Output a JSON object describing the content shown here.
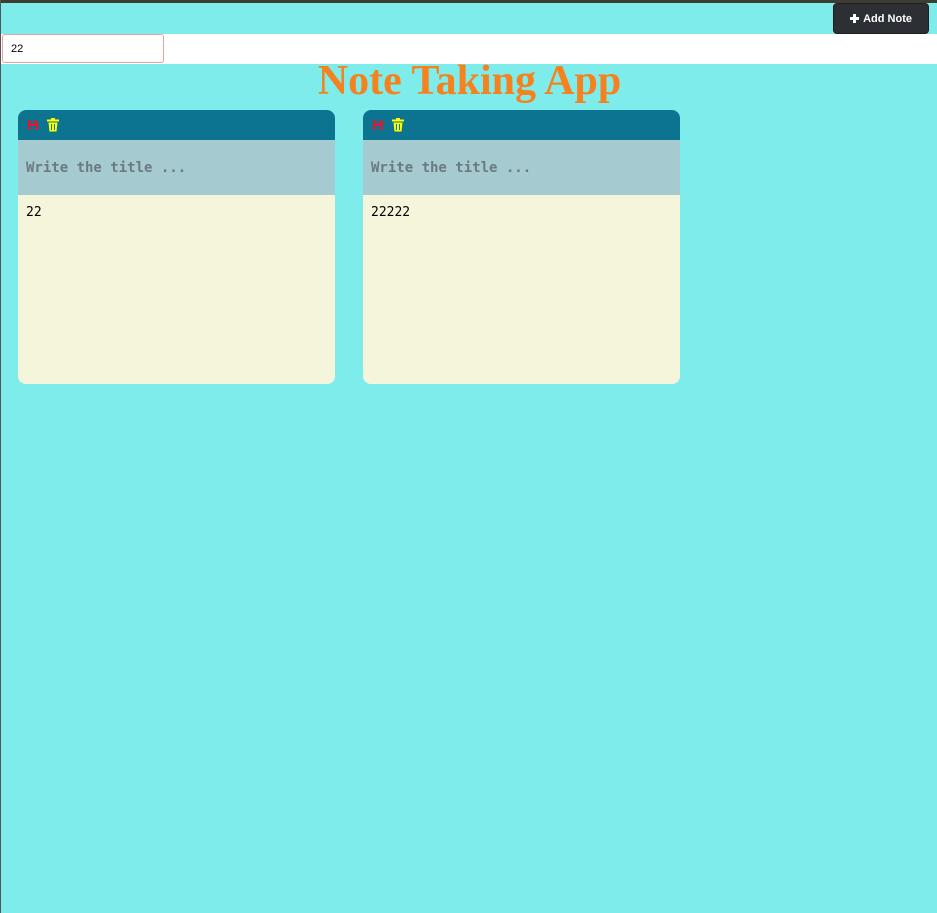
{
  "header": {
    "add_note_label": "Add Note"
  },
  "search": {
    "value": "22"
  },
  "page": {
    "title": "Note Taking App"
  },
  "notes": [
    {
      "title_value": "",
      "title_placeholder": "Write the title ...",
      "body": "22",
      "icons": [
        "save-icon",
        "trash-icon"
      ]
    },
    {
      "title_value": "",
      "title_placeholder": "Write the title ...",
      "body": "22222",
      "icons": [
        "save-icon",
        "trash-icon"
      ]
    }
  ],
  "colors": {
    "background": "#7fecec",
    "title": "#f5821f",
    "toolbar": "#0c7391",
    "title_area": "#a5cad0",
    "body_area": "#f5f5dc",
    "save_icon": "#e0182d",
    "trash_icon": "#ffff00",
    "add_button": "#2c2f33"
  }
}
